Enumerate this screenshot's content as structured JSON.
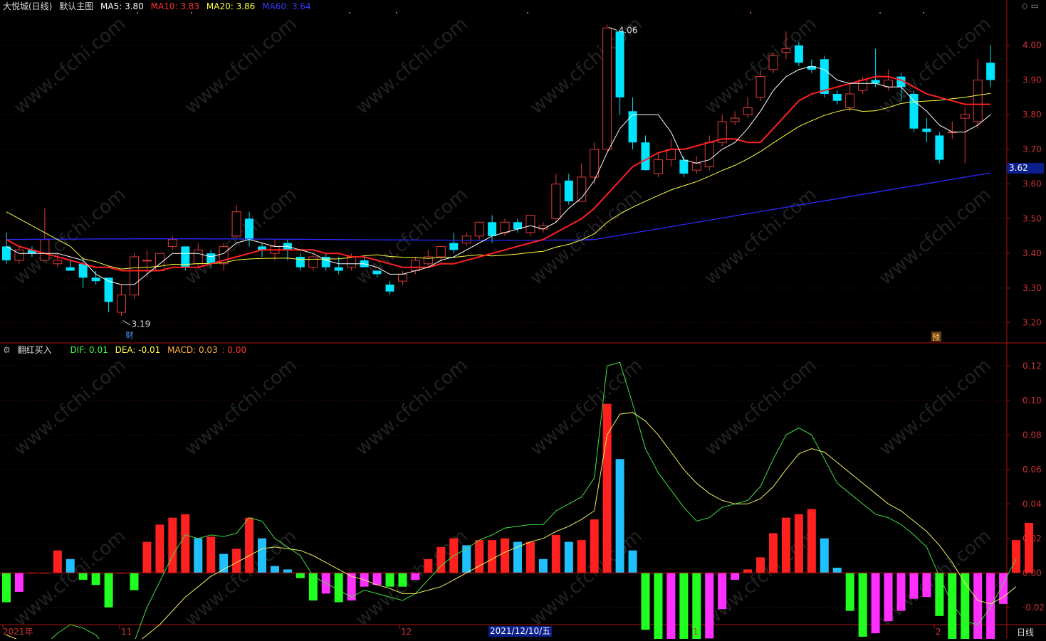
{
  "header_main": {
    "title": "大悦城(日线)",
    "indicator": "默认主图",
    "ma5_label": "MA5: 3.80",
    "ma10_label": "MA10: 3.83",
    "ma20_label": "MA20: 3.86",
    "ma60_label": "MA60: 3.64",
    "colors": {
      "ma5": "#ffffff",
      "ma10": "#ff2020",
      "ma20": "#ffff40",
      "ma60": "#2a2aff"
    }
  },
  "header_macd": {
    "indicator": "翻红买入",
    "dif_label": "DIF: 0.01",
    "dea_label": "DEA: -0.01",
    "macd_label": "MACD: 0.03",
    "extra_label": ": 0.00"
  },
  "last_price_tag": "3.62",
  "selected_date": "2021/12/10/五",
  "period_label": "日线",
  "watermark": "www.cfchi.com",
  "chart_data": [
    {
      "type": "candlestick",
      "title": "大悦城(日线)",
      "ylim": [
        3.15,
        4.1
      ],
      "y_ticks": [
        "4.00",
        "3.90",
        "3.80",
        "3.70",
        "3.60",
        "3.50",
        "3.40",
        "3.30",
        "3.20"
      ],
      "annotations": [
        {
          "text": "4.06",
          "label": "high"
        },
        {
          "text": "3.19",
          "label": "low"
        },
        {
          "text": "财",
          "label": "marker"
        },
        {
          "text": "预",
          "label": "marker"
        }
      ],
      "candles": [
        [
          3.42,
          3.38,
          3.46,
          3.37
        ],
        [
          3.38,
          3.41,
          3.42,
          3.37
        ],
        [
          3.41,
          3.4,
          3.42,
          3.39
        ],
        [
          3.38,
          3.44,
          3.53,
          3.38
        ],
        [
          3.37,
          3.38,
          3.4,
          3.36
        ],
        [
          3.36,
          3.35,
          3.38,
          3.35
        ],
        [
          3.37,
          3.33,
          3.39,
          3.3
        ],
        [
          3.33,
          3.32,
          3.35,
          3.31
        ],
        [
          3.33,
          3.26,
          3.33,
          3.23
        ],
        [
          3.23,
          3.28,
          3.31,
          3.22
        ],
        [
          3.28,
          3.39,
          3.4,
          3.27
        ],
        [
          3.38,
          3.38,
          3.41,
          3.33
        ],
        [
          3.35,
          3.4,
          3.4,
          3.35
        ],
        [
          3.42,
          3.44,
          3.45,
          3.41
        ],
        [
          3.42,
          3.36,
          3.42,
          3.35
        ],
        [
          3.37,
          3.41,
          3.43,
          3.36
        ],
        [
          3.4,
          3.37,
          3.41,
          3.36
        ],
        [
          3.37,
          3.42,
          3.43,
          3.35
        ],
        [
          3.45,
          3.52,
          3.54,
          3.44
        ],
        [
          3.5,
          3.44,
          3.52,
          3.42
        ],
        [
          3.42,
          3.41,
          3.43,
          3.39
        ],
        [
          3.4,
          3.42,
          3.44,
          3.38
        ],
        [
          3.43,
          3.41,
          3.44,
          3.38
        ],
        [
          3.39,
          3.36,
          3.4,
          3.35
        ],
        [
          3.36,
          3.39,
          3.4,
          3.35
        ],
        [
          3.39,
          3.36,
          3.4,
          3.35
        ],
        [
          3.36,
          3.35,
          3.39,
          3.34
        ],
        [
          3.36,
          3.39,
          3.4,
          3.35
        ],
        [
          3.38,
          3.36,
          3.39,
          3.36
        ],
        [
          3.35,
          3.34,
          3.35,
          3.33
        ],
        [
          3.31,
          3.29,
          3.32,
          3.28
        ],
        [
          3.32,
          3.34,
          3.35,
          3.31
        ],
        [
          3.35,
          3.38,
          3.39,
          3.34
        ],
        [
          3.37,
          3.39,
          3.41,
          3.36
        ],
        [
          3.39,
          3.42,
          3.42,
          3.37
        ],
        [
          3.43,
          3.41,
          3.46,
          3.4
        ],
        [
          3.43,
          3.45,
          3.46,
          3.42
        ],
        [
          3.45,
          3.49,
          3.49,
          3.44
        ],
        [
          3.49,
          3.45,
          3.51,
          3.43
        ],
        [
          3.46,
          3.49,
          3.5,
          3.45
        ],
        [
          3.49,
          3.47,
          3.5,
          3.46
        ],
        [
          3.46,
          3.51,
          3.51,
          3.45
        ],
        [
          3.47,
          3.48,
          3.49,
          3.46
        ],
        [
          3.5,
          3.6,
          3.63,
          3.49
        ],
        [
          3.61,
          3.55,
          3.63,
          3.54
        ],
        [
          3.55,
          3.62,
          3.66,
          3.55
        ],
        [
          3.62,
          3.7,
          3.72,
          3.6
        ],
        [
          3.7,
          4.05,
          4.06,
          3.69
        ],
        [
          4.04,
          3.85,
          4.04,
          3.8
        ],
        [
          3.81,
          3.72,
          3.85,
          3.7
        ],
        [
          3.72,
          3.64,
          3.74,
          3.64
        ],
        [
          3.63,
          3.67,
          3.69,
          3.62
        ],
        [
          3.67,
          3.7,
          3.73,
          3.65
        ],
        [
          3.67,
          3.63,
          3.68,
          3.62
        ],
        [
          3.64,
          3.66,
          3.68,
          3.63
        ],
        [
          3.65,
          3.72,
          3.74,
          3.64
        ],
        [
          3.72,
          3.78,
          3.8,
          3.71
        ],
        [
          3.78,
          3.79,
          3.81,
          3.77
        ],
        [
          3.8,
          3.82,
          3.85,
          3.79
        ],
        [
          3.85,
          3.91,
          3.93,
          3.84
        ],
        [
          3.93,
          3.97,
          3.98,
          3.92
        ],
        [
          3.98,
          3.99,
          4.04,
          3.96
        ],
        [
          4.0,
          3.95,
          4.01,
          3.94
        ],
        [
          3.94,
          3.93,
          3.96,
          3.92
        ],
        [
          3.96,
          3.86,
          3.97,
          3.85
        ],
        [
          3.86,
          3.84,
          3.87,
          3.83
        ],
        [
          3.82,
          3.86,
          3.89,
          3.81
        ],
        [
          3.87,
          3.9,
          3.91,
          3.86
        ],
        [
          3.9,
          3.89,
          3.99,
          3.88
        ],
        [
          3.88,
          3.9,
          3.93,
          3.87
        ],
        [
          3.91,
          3.88,
          3.92,
          3.84
        ],
        [
          3.86,
          3.76,
          3.87,
          3.75
        ],
        [
          3.76,
          3.75,
          3.79,
          3.72
        ],
        [
          3.74,
          3.67,
          3.75,
          3.66
        ],
        [
          3.75,
          3.75,
          3.78,
          3.73
        ],
        [
          3.79,
          3.8,
          3.82,
          3.66
        ],
        [
          3.78,
          3.9,
          3.96,
          3.76
        ],
        [
          3.95,
          3.9,
          4.0,
          3.88
        ]
      ],
      "bear_colors": [
        "#00e5ff"
      ],
      "bull_color": "#e03a3a",
      "ma5": [
        3.42,
        3.4,
        3.4,
        3.4,
        3.4,
        3.39,
        3.38,
        3.34,
        3.32,
        3.31,
        3.31,
        3.34,
        3.37,
        3.4,
        3.4,
        3.4,
        3.39,
        3.4,
        3.43,
        3.44,
        3.43,
        3.42,
        3.42,
        3.41,
        3.4,
        3.38,
        3.37,
        3.37,
        3.37,
        3.36,
        3.34,
        3.34,
        3.35,
        3.36,
        3.38,
        3.39,
        3.41,
        3.43,
        3.45,
        3.46,
        3.47,
        3.48,
        3.47,
        3.49,
        3.53,
        3.56,
        3.61,
        3.69,
        3.76,
        3.8,
        3.8,
        3.8,
        3.75,
        3.67,
        3.66,
        3.67,
        3.7,
        3.72,
        3.76,
        3.81,
        3.87,
        3.91,
        3.93,
        3.94,
        3.93,
        3.9,
        3.89,
        3.89,
        3.89,
        3.88,
        3.88,
        3.84,
        3.81,
        3.77,
        3.75,
        3.75,
        3.77,
        3.8
      ],
      "ma10": [
        3.44,
        3.42,
        3.41,
        3.4,
        3.39,
        3.38,
        3.37,
        3.36,
        3.36,
        3.35,
        3.35,
        3.35,
        3.35,
        3.36,
        3.36,
        3.36,
        3.37,
        3.38,
        3.39,
        3.4,
        3.41,
        3.41,
        3.41,
        3.41,
        3.41,
        3.4,
        3.4,
        3.39,
        3.39,
        3.38,
        3.37,
        3.36,
        3.36,
        3.36,
        3.37,
        3.37,
        3.38,
        3.39,
        3.4,
        3.41,
        3.42,
        3.43,
        3.44,
        3.46,
        3.48,
        3.5,
        3.53,
        3.57,
        3.61,
        3.65,
        3.67,
        3.69,
        3.7,
        3.7,
        3.71,
        3.72,
        3.73,
        3.73,
        3.72,
        3.72,
        3.76,
        3.8,
        3.84,
        3.86,
        3.87,
        3.88,
        3.89,
        3.9,
        3.91,
        3.91,
        3.9,
        3.88,
        3.86,
        3.85,
        3.84,
        3.83,
        3.83,
        3.83
      ]
    },
    {
      "type": "bar",
      "title": "翻红买入",
      "ylim": [
        -0.03,
        0.13
      ],
      "y_ticks": [
        "0.12",
        "0.10",
        "0.08",
        "0.06",
        "0.04",
        "0.02",
        "0.00",
        "-0.02"
      ],
      "x_ticks": [
        "2021年",
        "11",
        "12",
        "2021/12/10/五",
        "1",
        "2"
      ],
      "macd": [
        -0.017,
        -0.011,
        0,
        0,
        0.013,
        0.008,
        -0.004,
        -0.007,
        -0.02,
        0,
        -0.01,
        0.018,
        0.028,
        0.032,
        0.034,
        0.02,
        0.021,
        0.011,
        0.014,
        0.032,
        0.02,
        0.004,
        0.002,
        -0.003,
        -0.016,
        -0.012,
        -0.017,
        -0.016,
        -0.008,
        -0.007,
        -0.008,
        -0.008,
        -0.004,
        0.008,
        0.015,
        0.02,
        0.016,
        0.019,
        0.019,
        0.02,
        0.018,
        0.018,
        0.008,
        0.022,
        0.018,
        0.019,
        0.031,
        0.098,
        0.066,
        0.013,
        -0.033,
        -0.041,
        -0.04,
        -0.043,
        -0.046,
        -0.038,
        -0.021,
        -0.004,
        0.002,
        0.009,
        0.023,
        0.032,
        0.034,
        0.037,
        0.02,
        0.003,
        -0.022,
        -0.037,
        -0.035,
        -0.028,
        -0.022,
        -0.015,
        -0.014,
        -0.025,
        -0.04,
        -0.053,
        -0.05,
        -0.039,
        -0.018,
        0.019,
        0.029
      ],
      "dif": [
        -0.044,
        -0.045,
        -0.046,
        -0.042,
        -0.035,
        -0.03,
        -0.032,
        -0.036,
        -0.045,
        -0.048,
        -0.04,
        -0.02,
        -0.005,
        0.01,
        0.022,
        0.02,
        0.022,
        0.021,
        0.023,
        0.032,
        0.03,
        0.02,
        0.015,
        0.01,
        -0.002,
        -0.006,
        -0.01,
        -0.014,
        -0.01,
        -0.012,
        -0.014,
        -0.016,
        -0.012,
        -0.004,
        0.004,
        0.01,
        0.014,
        0.019,
        0.022,
        0.026,
        0.027,
        0.028,
        0.028,
        0.036,
        0.04,
        0.044,
        0.055,
        0.12,
        0.122,
        0.098,
        0.072,
        0.058,
        0.048,
        0.038,
        0.03,
        0.032,
        0.038,
        0.04,
        0.042,
        0.05,
        0.066,
        0.08,
        0.084,
        0.08,
        0.066,
        0.052,
        0.046,
        0.04,
        0.034,
        0.032,
        0.028,
        0.022,
        0.015,
        -0.002,
        -0.018,
        -0.028,
        -0.03,
        -0.02,
        -0.006,
        0.008
      ],
      "dea": [
        -0.036,
        -0.039,
        -0.04,
        -0.04,
        -0.04,
        -0.04,
        -0.04,
        -0.04,
        -0.042,
        -0.044,
        -0.042,
        -0.036,
        -0.03,
        -0.022,
        -0.014,
        -0.008,
        -0.002,
        0.002,
        0.006,
        0.01,
        0.014,
        0.015,
        0.014,
        0.013,
        0.01,
        0.006,
        0.002,
        -0.002,
        -0.004,
        -0.007,
        -0.009,
        -0.012,
        -0.012,
        -0.01,
        -0.008,
        -0.004,
        0.0,
        0.004,
        0.008,
        0.012,
        0.015,
        0.018,
        0.02,
        0.024,
        0.027,
        0.031,
        0.036,
        0.08,
        0.092,
        0.093,
        0.088,
        0.08,
        0.07,
        0.06,
        0.052,
        0.046,
        0.042,
        0.04,
        0.04,
        0.043,
        0.05,
        0.06,
        0.069,
        0.072,
        0.07,
        0.064,
        0.058,
        0.052,
        0.046,
        0.04,
        0.036,
        0.03,
        0.024,
        0.016,
        0.006,
        -0.006,
        -0.016,
        -0.018,
        -0.014,
        -0.008
      ]
    }
  ]
}
